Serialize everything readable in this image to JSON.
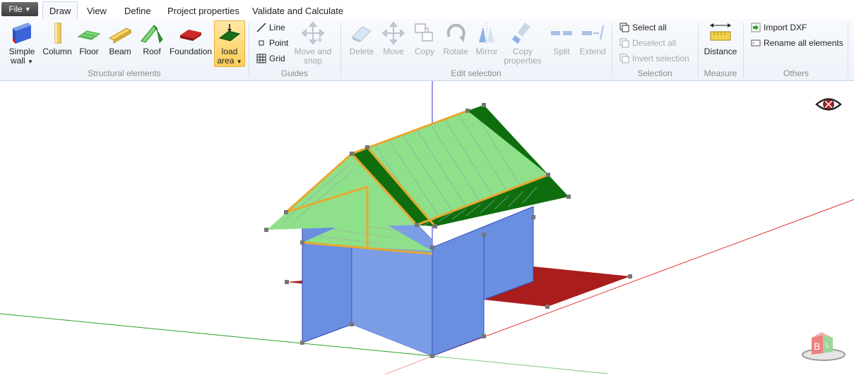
{
  "file_menu": {
    "label": "File",
    "arrow": "▼"
  },
  "tabs": [
    {
      "label": "Draw",
      "active": true
    },
    {
      "label": "View"
    },
    {
      "label": "Define"
    },
    {
      "label": "Project properties"
    },
    {
      "label": "Validate and Calculate"
    }
  ],
  "structural": {
    "group_label": "Structural elements",
    "simple_wall": "Simple",
    "simple_wall2": "wall",
    "column": "Column",
    "floor": "Floor",
    "beam": "Beam",
    "roof": "Roof",
    "foundation": "Foundation",
    "load_area": "load",
    "load_area2": "area"
  },
  "guides": {
    "group_label": "Guides",
    "line": "Line",
    "point": "Point",
    "grid": "Grid",
    "move_snap": "Move and",
    "move_snap2": "snap"
  },
  "edit": {
    "group_label": "Edit selection",
    "delete": "Delete",
    "move": "Move",
    "copy": "Copy",
    "rotate": "Rotate",
    "mirror": "Mirror",
    "copy_props": "Copy",
    "copy_props2": "properties",
    "split": "Split",
    "extend": "Extend"
  },
  "selection": {
    "group_label": "Selection",
    "select_all": "Select all",
    "deselect_all": "Deselect all",
    "invert": "Invert selection"
  },
  "measure": {
    "group_label": "Measure",
    "distance": "Distance"
  },
  "others": {
    "group_label": "Others",
    "import_dxf": "Import DXF",
    "rename": "Rename all elements"
  },
  "colors": {
    "wall": "#6a8fe0",
    "roof_light": "#8fe08a",
    "roof_dark": "#0e6e0e",
    "foundation": "#a91d1d",
    "beam": "#e8a830",
    "axis_x": "#e03030",
    "axis_y": "#28a028",
    "axis_z": "#3030e0"
  }
}
